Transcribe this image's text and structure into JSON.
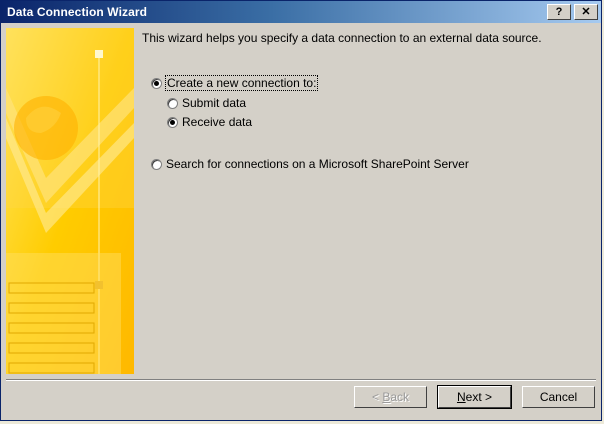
{
  "window": {
    "title": "Data Connection Wizard",
    "help_label": "?",
    "close_label": "✕"
  },
  "intro_text": "This wizard helps you specify a data connection to an external data source.",
  "options": {
    "create": {
      "label": "Create a new connection to:",
      "selected": true
    },
    "submit": {
      "label": "Submit data",
      "selected": false
    },
    "receive": {
      "label": "Receive data",
      "selected": true
    },
    "search": {
      "label": "Search for connections on a Microsoft SharePoint Server",
      "selected": false
    }
  },
  "buttons": {
    "back": {
      "prefix": "< ",
      "access": "B",
      "rest": "ack",
      "enabled": false
    },
    "next": {
      "access": "N",
      "rest": "ext >"
    },
    "cancel": "Cancel"
  },
  "colors": {
    "accent": "#0A246A",
    "graphic_yellow": "#FFD200"
  }
}
